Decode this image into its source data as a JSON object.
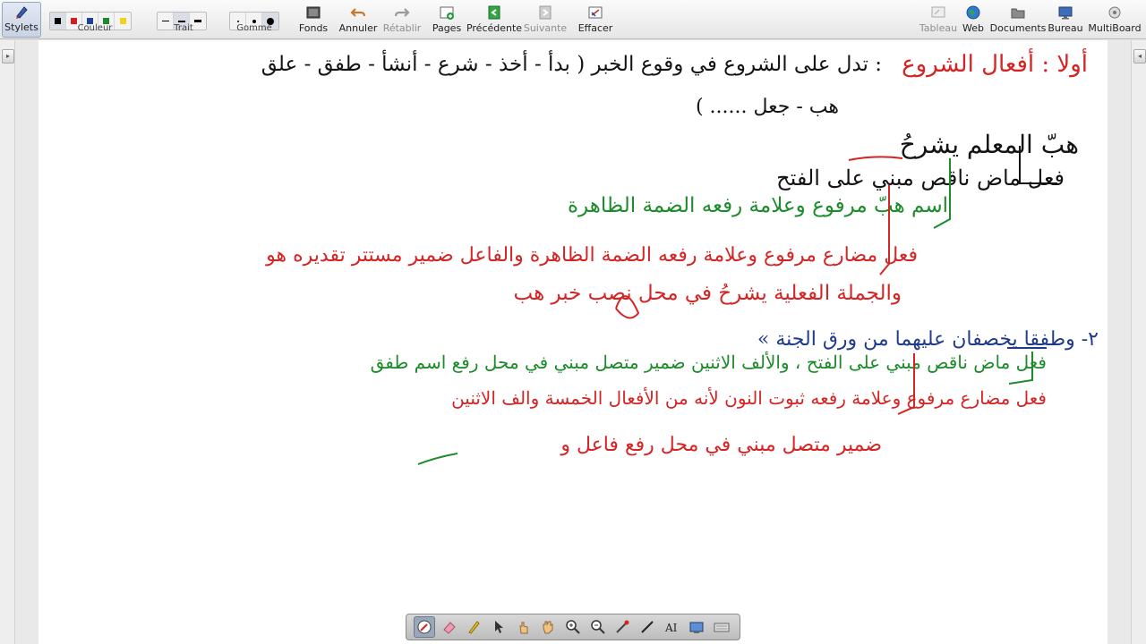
{
  "toolbar": {
    "left_buttons": [
      {
        "name": "stylets-button",
        "label": "Stylets",
        "icon": "stylus-icon",
        "active": true
      },
      {
        "name": "fonds-button",
        "label": "Fonds",
        "icon": "background-icon"
      },
      {
        "name": "annuler-button",
        "label": "Annuler",
        "icon": "undo-icon"
      },
      {
        "name": "retablir-button",
        "label": "Rétablir",
        "icon": "redo-icon",
        "disabled": true
      },
      {
        "name": "pages-button",
        "label": "Pages",
        "icon": "add-page-icon"
      },
      {
        "name": "precedente-button",
        "label": "Précédente",
        "icon": "previous-page-icon"
      },
      {
        "name": "suivante-button",
        "label": "Suivante",
        "icon": "next-page-icon",
        "disabled": true
      },
      {
        "name": "effacer-button",
        "label": "Effacer",
        "icon": "clear-icon"
      }
    ],
    "right_buttons": [
      {
        "name": "tableau-button",
        "label": "Tableau",
        "icon": "board-icon",
        "disabled": true
      },
      {
        "name": "web-button",
        "label": "Web",
        "icon": "globe-icon"
      },
      {
        "name": "documents-button",
        "label": "Documents",
        "icon": "folder-icon"
      },
      {
        "name": "bureau-button",
        "label": "Bureau",
        "icon": "monitor-icon"
      },
      {
        "name": "multiboard-button",
        "label": "MultiBoard",
        "icon": "multiboard-icon"
      }
    ],
    "color_group": {
      "label": "Couleur",
      "colors": [
        "#000000",
        "#d41f1f",
        "#1e3f9a",
        "#1e8a2d",
        "#f2d21b"
      ],
      "selected_index": 0
    },
    "stroke_group": {
      "label": "Trait",
      "selected_index": 1
    },
    "eraser_group": {
      "label": "Gomme",
      "selected_index": 2
    }
  },
  "palette": {
    "tools": [
      "pen-tool-icon",
      "eraser-tool-icon",
      "highlighter-tool-icon",
      "pointer-tool-icon",
      "hand-select-tool-icon",
      "pan-hand-tool-icon",
      "zoom-in-tool-icon",
      "zoom-out-tool-icon",
      "laser-tool-icon",
      "line-tool-icon",
      "text-tool-icon",
      "screen-capture-tool-icon",
      "keyboard-tool-icon"
    ],
    "selected_index": 0
  },
  "board": {
    "colors": {
      "black": "#141414",
      "red": "#d52424",
      "green": "#1c8b2a",
      "blue": "#1f3b8c"
    },
    "lines": [
      {
        "id": "line1-title",
        "color": "red",
        "text": "أولا : أفعال الشروع"
      },
      {
        "id": "line1-def",
        "color": "black",
        "text": ": تدل على الشروع في وقوع الخبر ( بدأ - أخذ - شرع - أنشأ - طفق - علق"
      },
      {
        "id": "line2-def",
        "color": "black",
        "text": "هب - جعل ...... )"
      },
      {
        "id": "example1",
        "color": "black",
        "text": "هبّ المعلم يشرحُ"
      },
      {
        "id": "analysis1-verb",
        "color": "black",
        "text": "فعل ماض ناقص مبني على الفتح"
      },
      {
        "id": "analysis1-noun",
        "color": "green",
        "text": "اسم هبّ مرفوع وعلامة رفعه الضمة الظاهرة"
      },
      {
        "id": "analysis1-pred",
        "color": "red",
        "text": "فعل مضارع مرفوع وعلامة رفعه الضمة الظاهرة والفاعل ضمير مستتر تقديره هو"
      },
      {
        "id": "analysis1-pred2",
        "color": "red",
        "text": "والجملة الفعلية يشرحُ في محل نصب خبر هب"
      },
      {
        "id": "example2",
        "color": "blue",
        "text": "٢- وطفقا يخصفان عليهما من ورق الجنة »"
      },
      {
        "id": "analysis2-verb",
        "color": "green",
        "text": "فعل ماض ناقص مبني على الفتح ، والألف الاثنين ضمير متصل مبني في محل رفع اسم طفق"
      },
      {
        "id": "analysis2-pred",
        "color": "red",
        "text": "فعل مضارع مرفوع وعلامة رفعه ثبوت النون لأنه من الأفعال الخمسة والف الاثنين"
      },
      {
        "id": "analysis2-pred2",
        "color": "red",
        "text": "ضمير متصل مبني في محل رفع فاعل و"
      }
    ]
  }
}
